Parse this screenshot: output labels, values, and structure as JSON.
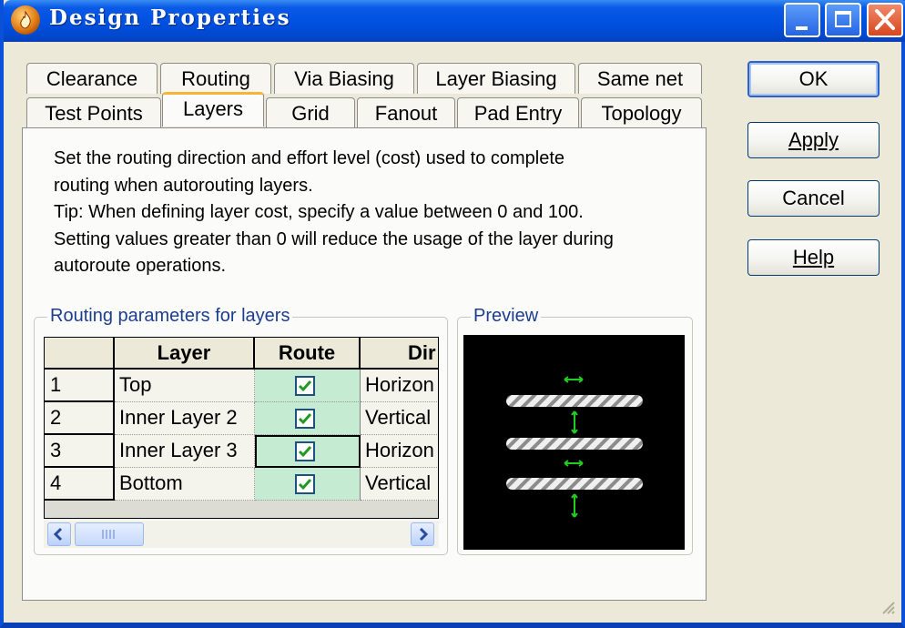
{
  "window": {
    "title": "Design Properties"
  },
  "tabs_back_row": [
    "Clearance",
    "Routing",
    "Via Biasing",
    "Layer Biasing",
    "Same net"
  ],
  "tabs_front_row": [
    "Test Points",
    "Layers",
    "Grid",
    "Fanout",
    "Pad Entry",
    "Topology"
  ],
  "active_tab": "Layers",
  "description": [
    "Set the routing direction and effort level (cost) used to complete",
    "routing when autorouting layers.",
    "Tip: When defining layer cost, specify a value between 0 and 100.",
    "Setting values greater than 0 will reduce the usage of the layer during",
    "autoroute operations."
  ],
  "routing_group": {
    "label": "Routing parameters for layers",
    "columns": [
      "Layer",
      "Route",
      "Dir"
    ],
    "rows": [
      {
        "num": "1",
        "layer": "Top",
        "route": true,
        "dir": "Horizon"
      },
      {
        "num": "2",
        "layer": "Inner Layer 2",
        "route": true,
        "dir": "Vertical"
      },
      {
        "num": "3",
        "layer": "Inner Layer 3",
        "route": true,
        "dir": "Horizon"
      },
      {
        "num": "4",
        "layer": "Bottom",
        "route": true,
        "dir": "Vertical"
      }
    ]
  },
  "preview_group": {
    "label": "Preview"
  },
  "buttons": {
    "ok": "OK",
    "apply": "Apply",
    "cancel": "Cancel",
    "help": "Help"
  },
  "icons": [
    "app-flame-icon",
    "minimize-icon",
    "maximize-icon",
    "close-icon",
    "checkbox-checked-icon",
    "scroll-left-icon",
    "scroll-right-icon",
    "horizontal-arrow-icon",
    "vertical-arrow-icon",
    "size-grip-icon"
  ],
  "colors": {
    "title_bar": "#0050e0",
    "dialog_bg": "#ece9d8",
    "route_cell": "#c5ecd2",
    "preview_arrows": "#22cc22",
    "active_tab_accent": "#f5b53a"
  }
}
